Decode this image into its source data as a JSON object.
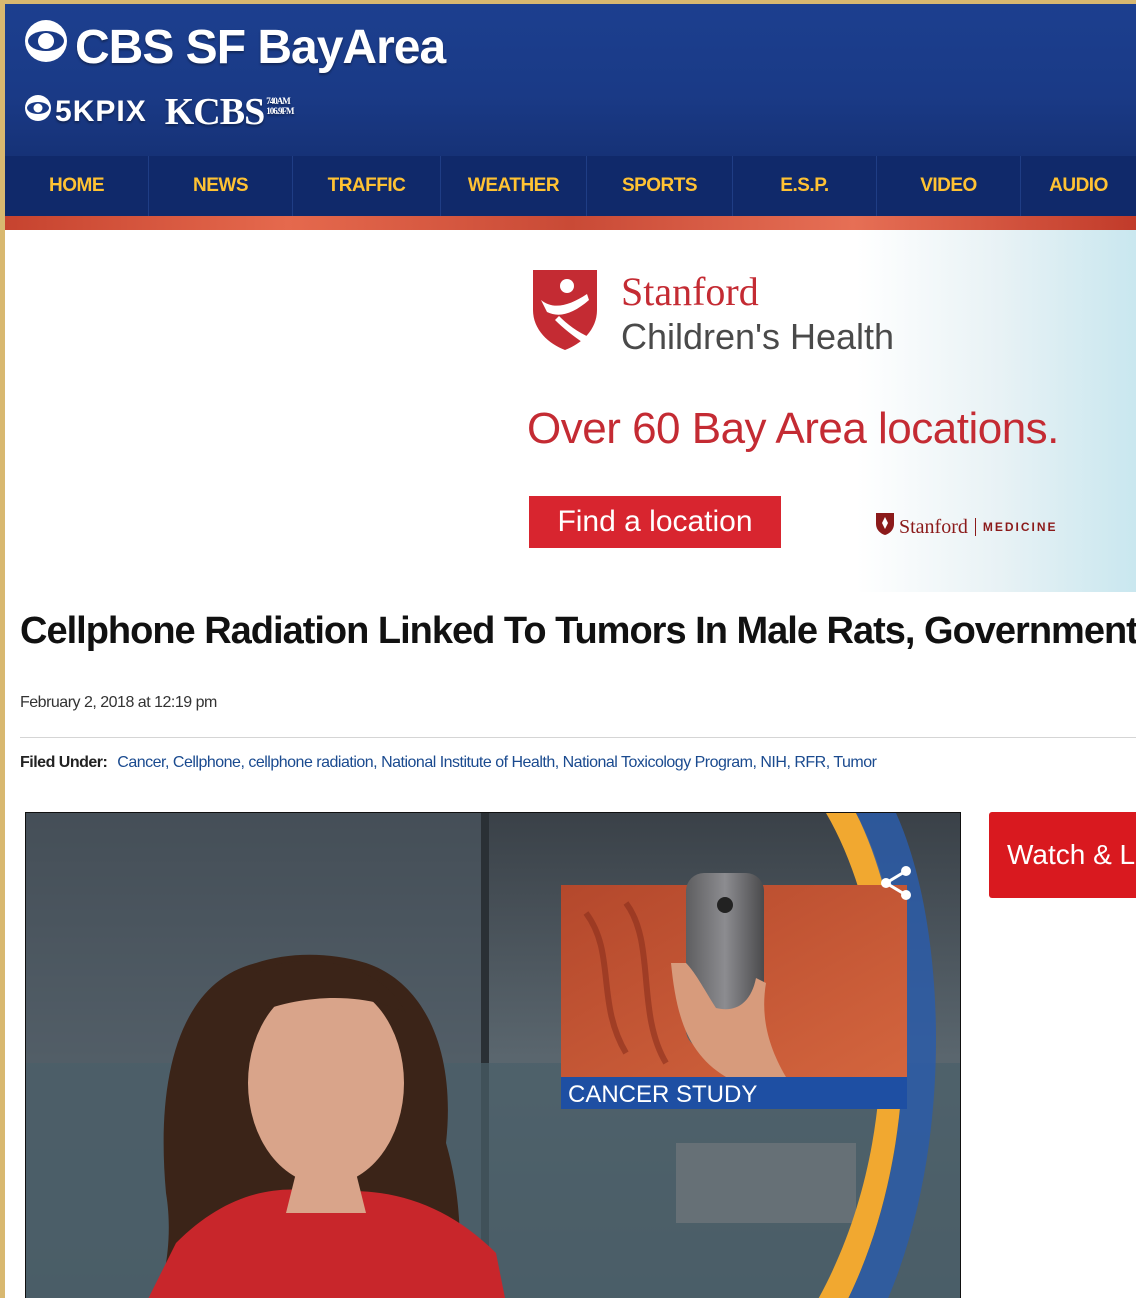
{
  "header": {
    "site_name": "CBS SF BayArea",
    "station1": "KPIX",
    "station1_prefix": "5",
    "station2": "KCBS",
    "station2_freq_top": "740AM",
    "station2_freq_bottom": "106.9FM"
  },
  "nav": {
    "items": [
      {
        "label": "HOME",
        "w": 144
      },
      {
        "label": "NEWS",
        "w": 144
      },
      {
        "label": "TRAFFIC",
        "w": 148
      },
      {
        "label": "WEATHER",
        "w": 146
      },
      {
        "label": "SPORTS",
        "w": 146
      },
      {
        "label": "E.S.P.",
        "w": 144
      },
      {
        "label": "VIDEO",
        "w": 144
      },
      {
        "label": "AUDIO",
        "w": 115
      }
    ]
  },
  "ad": {
    "brand_line1": "Stanford",
    "brand_line2": "Children's Health",
    "headline": "Over 60 Bay Area locations.",
    "button_label": "Find a location",
    "partner_name": "Stanford",
    "partner_sub": "MEDICINE"
  },
  "article": {
    "headline": "Cellphone Radiation Linked To Tumors In Male Rats, Government",
    "date": "February 2, 2018 at 12:19 pm",
    "filed_label": "Filed Under:",
    "tags": [
      "Cancer",
      "Cellphone",
      "cellphone radiation",
      "National Institute of Health",
      "National Toxicology Program",
      "NIH",
      "RFR",
      "Tumor"
    ]
  },
  "video": {
    "lower_third_label": "CANCER STUDY"
  },
  "sidebar": {
    "watch_button": "Watch & L"
  },
  "colors": {
    "brand_blue": "#1a3a86",
    "nav_text": "#ffc233",
    "ad_red": "#c42b33",
    "watch_red": "#d9191f",
    "link_blue": "#1a4a8f"
  }
}
